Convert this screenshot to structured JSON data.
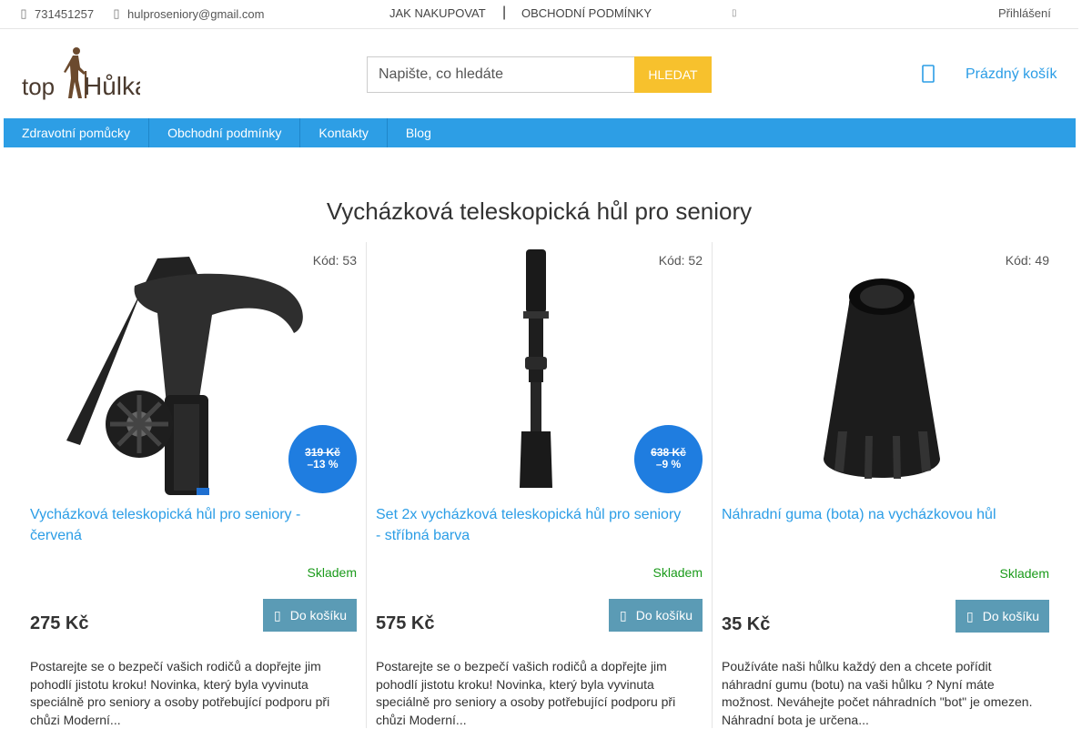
{
  "topbar": {
    "phone": "731451257",
    "email": "hulproseniory@gmail.com",
    "link1": "JAK NAKUPOVAT",
    "separator": "|",
    "link2": "OBCHODNÍ PODMÍNKY",
    "small_glyph": "▯",
    "login": "Přihlášení"
  },
  "logo": {
    "text_top": "top",
    "text_main": "Hůlka"
  },
  "search": {
    "placeholder": "Napište, co hledáte",
    "button": "HLEDAT"
  },
  "cart": {
    "label": "Prázdný košík",
    "icon": "cart-icon"
  },
  "nav": [
    "Zdravotní pomůcky",
    "Obchodní podmínky",
    "Kontakty",
    "Blog"
  ],
  "page_title": "Vycházková teleskopická hůl pro seniory",
  "products": [
    {
      "code": "Kód: 53",
      "title": "Vycházková teleskopická hůl pro seniory - červená",
      "old_price": "319 Kč",
      "discount": "–13 %",
      "stock": "Skladem",
      "price": "275 Kč",
      "button": "Do košíku",
      "description": "Postarejte se o bezpečí vašich rodičů a dopřejte jim pohodlí jistotu kroku! Novinka, který byla vyvinuta speciálně pro seniory a osoby potřebující podporu při chůzi Moderní..."
    },
    {
      "code": "Kód: 52",
      "title": "Set 2x vycházková teleskopická hůl pro seniory - stříbná barva",
      "old_price": "638 Kč",
      "discount": "–9 %",
      "stock": "Skladem",
      "price": "575 Kč",
      "button": "Do košíku",
      "description": "Postarejte se o bezpečí vašich rodičů a dopřejte jim pohodlí jistotu kroku! Novinka, který byla vyvinuta speciálně pro seniory a osoby potřebující podporu při chůzi Moderní..."
    },
    {
      "code": "Kód: 49",
      "title": "Náhradní guma (bota) na vycházkovou hůl",
      "stock": "Skladem",
      "price": "35 Kč",
      "button": "Do košíku",
      "description": "Používáte naši hůlku každý den a chcete pořídit náhradní gumu (botu) na vaši hůlku ? Nyní máte možnost. Neváhejte počet náhradních \"bot\" je omezen. Náhradní bota je určena..."
    }
  ],
  "colors": {
    "accent": "#2d9ee5",
    "search_button": "#f7c12d",
    "badge": "#1f7de0",
    "buy_button": "#5b9bb5",
    "stock": "#1a9a1a"
  }
}
